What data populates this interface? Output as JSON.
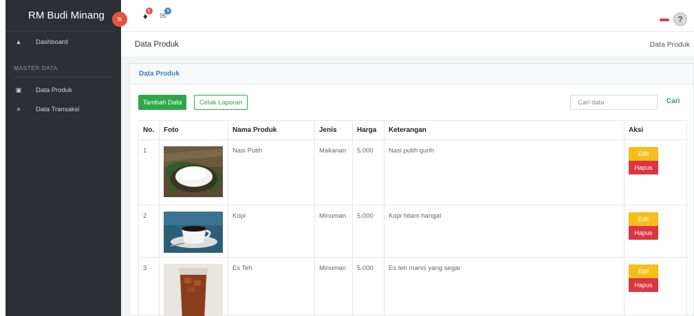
{
  "brand": "RM Budi Minang",
  "sidebar": {
    "dashboard": "Dashboard",
    "section": "MASTER DATA",
    "items": [
      "Data Produk",
      "Data Transaksi"
    ]
  },
  "topbar": {
    "bell_count": "5",
    "mail_count": "9"
  },
  "breadcrumb": {
    "title": "Data Produk",
    "right": "Data Produk"
  },
  "card": {
    "title": "Data Produk",
    "add_label": "Tambah Data",
    "print_label": "Cetak Laporan",
    "search_placeholder": "Cari data",
    "search_label": "Cari"
  },
  "table": {
    "headers": [
      "No.",
      "Foto",
      "Nama Produk",
      "Jenis",
      "Harga",
      "Keterangan",
      "Aksi"
    ],
    "rows": [
      {
        "no": "1",
        "name": "Nasi Putih",
        "type": "Makanan",
        "price": "5.000",
        "desc": "Nasi putih gurih"
      },
      {
        "no": "2",
        "name": "Kopi",
        "type": "Minuman",
        "price": "5.000",
        "desc": "Kopi hitam hangat"
      },
      {
        "no": "3",
        "name": "Es Teh",
        "type": "Minuman",
        "price": "5.000",
        "desc": "Es teh manis yang segar"
      }
    ],
    "edit_label": "Edit",
    "delete_label": "Hapus"
  },
  "colors": {
    "accent": "#2ea749",
    "danger": "#dc3545",
    "warning": "#f6be1a",
    "sidebar": "#2c2f34"
  }
}
